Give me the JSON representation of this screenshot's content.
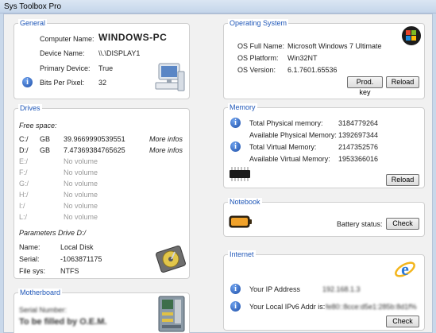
{
  "window": {
    "title": "Sys Toolbox Pro"
  },
  "general": {
    "title": "General",
    "computer_name_label": "Computer Name:",
    "computer_name": "WINDOWS-PC",
    "device_name_label": "Device Name:",
    "device_name": "\\\\.\\DISPLAY1",
    "primary_label": "Primary Device:",
    "primary": "True",
    "bits_label": "Bits Per Pixel:",
    "bits": "32",
    "icon": "computer-icon"
  },
  "os": {
    "title": "Operating System",
    "full_label": "OS Full Name:",
    "full": "Microsoft Windows 7 Ultimate",
    "platform_label": "OS Platform:",
    "platform": "Win32NT",
    "version_label": "OS Version:",
    "version": "6.1.7601.65536",
    "prod_key_button": "Prod. key",
    "reload_button": "Reload",
    "icon": "windows-logo-icon"
  },
  "drives": {
    "title": "Drives",
    "free_space_label": "Free space:",
    "rows": [
      {
        "letter": "C:/",
        "unit": "GB",
        "value": "39.9669990539551",
        "more": "More infos"
      },
      {
        "letter": "D:/",
        "unit": "GB",
        "value": "7.47369384765625",
        "more": "More infos"
      },
      {
        "letter": "E:/",
        "unit": "",
        "value": "No volume",
        "more": ""
      },
      {
        "letter": "F:/",
        "unit": "",
        "value": "No volume",
        "more": ""
      },
      {
        "letter": "G:/",
        "unit": "",
        "value": "No volume",
        "more": ""
      },
      {
        "letter": "H:/",
        "unit": "",
        "value": "No volume",
        "more": ""
      },
      {
        "letter": "I:/",
        "unit": "",
        "value": "No volume",
        "more": ""
      },
      {
        "letter": "L:/",
        "unit": "",
        "value": "No volume",
        "more": ""
      }
    ],
    "params_label": "Parameters Drive D:/",
    "name_label": "Name:",
    "name": "Local Disk",
    "serial_label": "Serial:",
    "serial": "-1063871175",
    "filesys_label": "File sys:",
    "filesys": "NTFS",
    "icon": "hard-disk-icon"
  },
  "memory": {
    "title": "Memory",
    "total_phys_label": "Total Physical memory:",
    "total_phys": "3184779264",
    "avail_phys_label": "Available Physical Memory:",
    "avail_phys": "1392697344",
    "total_virt_label": "Total Virtual Memory:",
    "total_virt": "2147352576",
    "avail_virt_label": "Available Virtual Memory:",
    "avail_virt": "1953366016",
    "reload_button": "Reload",
    "icon": "memory-chip-icon"
  },
  "notebook": {
    "title": "Notebook",
    "battery_label": "Battery status:",
    "check_button": "Check",
    "icon": "battery-icon"
  },
  "internet": {
    "title": "Internet",
    "ip_label": "Your IP Address",
    "ip": "192.168.1.3",
    "ipv6_label": "Your Local IPv6 Addr is:",
    "ipv6": "fe80::8cce:d5e1:285b:8d1f%",
    "check_button": "Check",
    "icon": "internet-explorer-icon"
  },
  "motherboard": {
    "title": "Motherboard",
    "serial_label": "Serial Number:",
    "serial": "To be filled by O.E.M.",
    "icon": "motherboard-icon"
  }
}
